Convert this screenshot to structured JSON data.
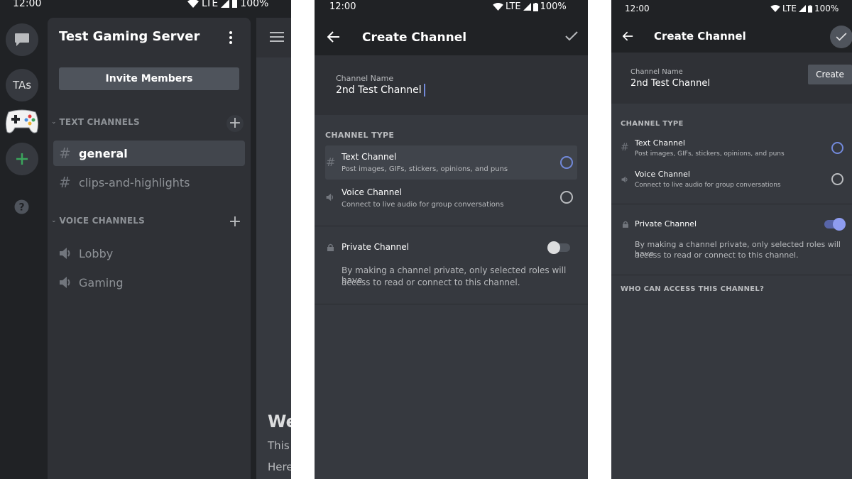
{
  "phone1": {
    "status": {
      "time": "12:00",
      "network": "LTE",
      "battery": "100%"
    },
    "guilds": [
      {
        "type": "dm",
        "icon": "chat-bubble-icon"
      },
      {
        "type": "text",
        "label": "TAs"
      },
      {
        "type": "image",
        "icon": "game-controller-icon"
      },
      {
        "type": "add",
        "icon": "plus-icon"
      },
      {
        "type": "help",
        "icon": "question-icon"
      }
    ],
    "server_name": "Test Gaming Server",
    "invite_label": "Invite Members",
    "text_category": "TEXT CHANNELS",
    "text_channels": [
      "general",
      "clips-and-highlights"
    ],
    "voice_category": "VOICE CHANNELS",
    "voice_channels": [
      "Lobby",
      "Gaming"
    ],
    "chat_peek": {
      "heading": "We",
      "line1": "This",
      "line2": "Here"
    }
  },
  "phone2": {
    "status": {
      "time": "12:00",
      "network": "LTE",
      "battery": "100%"
    },
    "title": "Create Channel",
    "name_label": "Channel Name",
    "name_value": "2nd Test Channel",
    "type_header": "CHANNEL TYPE",
    "text_option": {
      "title": "Text Channel",
      "subtitle": "Post images, GIFs, stickers, opinions, and puns",
      "selected": true
    },
    "voice_option": {
      "title": "Voice Channel",
      "subtitle": "Connect to live audio for group conversations",
      "selected": false
    },
    "private_label": "Private Channel",
    "private_enabled": false,
    "private_desc_1": "By making a channel private, only selected roles will have",
    "private_desc_2": "access to read or connect to this channel."
  },
  "phone3": {
    "status": {
      "time": "12:00",
      "network": "LTE",
      "battery": "100%"
    },
    "title": "Create Channel",
    "name_label": "Channel Name",
    "name_value": "2nd Test Channel",
    "create_tooltip": "Create",
    "type_header": "CHANNEL TYPE",
    "text_option": {
      "title": "Text Channel",
      "subtitle": "Post images, GIFs, stickers, opinions, and puns",
      "selected": true
    },
    "voice_option": {
      "title": "Voice Channel",
      "subtitle": "Connect to live audio for group conversations",
      "selected": false
    },
    "private_label": "Private Channel",
    "private_enabled": true,
    "private_desc_1": "By making a channel private, only selected roles will have",
    "private_desc_2": "access to read or connect to this channel.",
    "access_header": "WHO CAN ACCESS THIS CHANNEL?"
  },
  "colors": {
    "blurple": "#7289da",
    "green": "#3ba55c",
    "panel": "#2f3136",
    "rail": "#202225",
    "content": "#36393f"
  }
}
